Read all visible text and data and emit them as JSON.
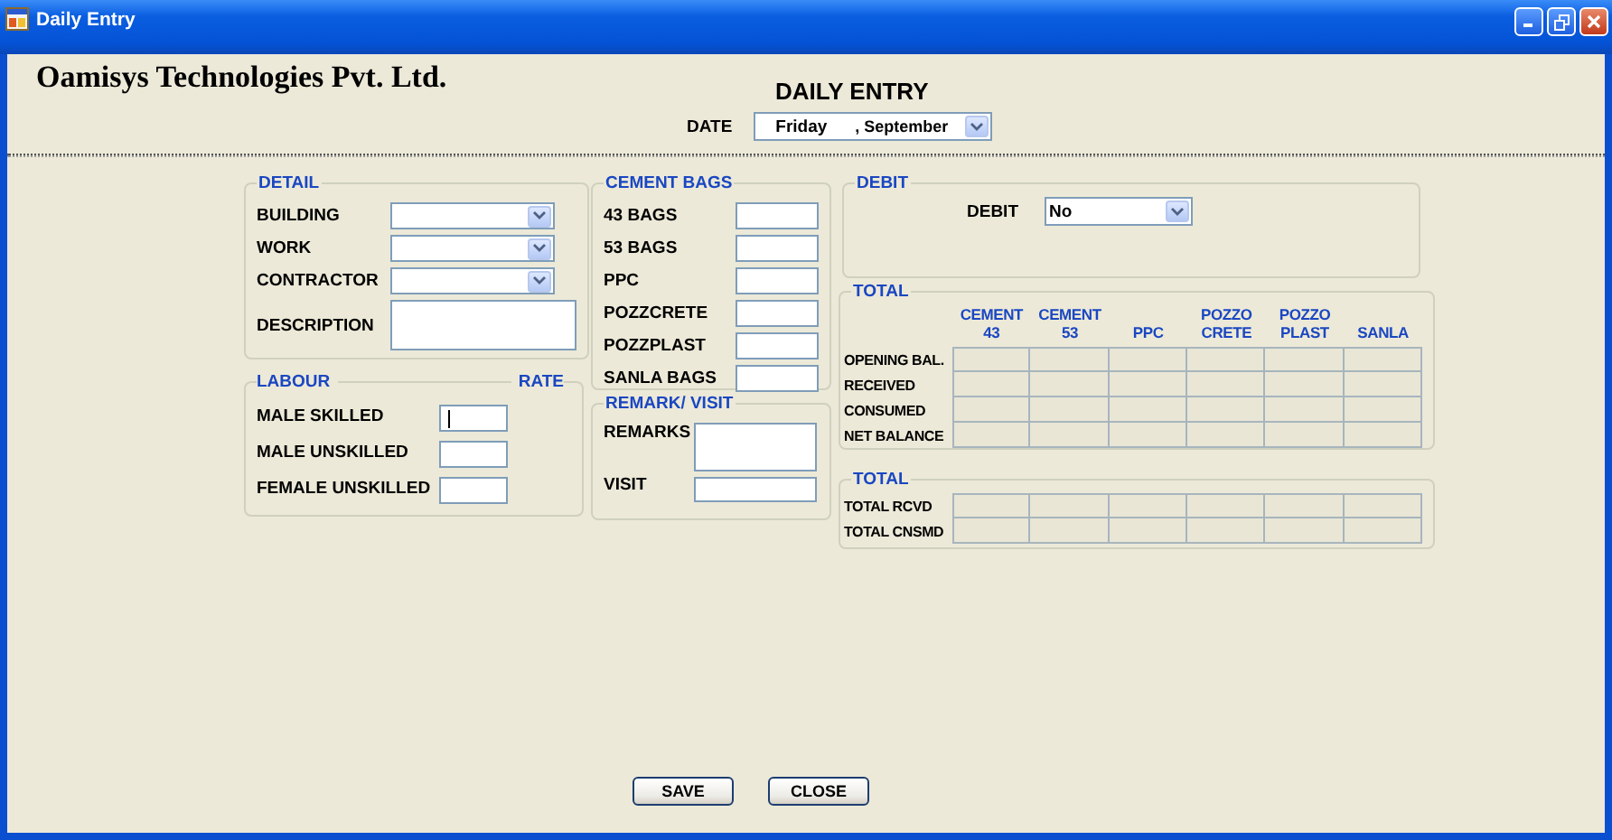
{
  "window": {
    "title": "Daily Entry"
  },
  "header": {
    "company": "Oamisys Technologies Pvt. Ltd.",
    "title": "DAILY ENTRY",
    "date_label": "DATE",
    "date_day": "Friday",
    "date_month": ", September"
  },
  "detail": {
    "legend": "DETAIL",
    "fields": [
      {
        "label": "BUILDING",
        "kind": "combo"
      },
      {
        "label": "WORK",
        "kind": "combo"
      },
      {
        "label": "CONTRACTOR",
        "kind": "combo"
      },
      {
        "label": "DESCRIPTION",
        "kind": "textarea"
      }
    ]
  },
  "labour": {
    "legend": "LABOUR",
    "rate_header": "RATE",
    "fields": [
      {
        "label": "MALE SKILLED",
        "focused": true
      },
      {
        "label": "MALE UNSKILLED",
        "focused": false
      },
      {
        "label": "FEMALE UNSKILLED",
        "focused": false
      }
    ]
  },
  "cement_bags": {
    "legend": "CEMENT BAGS",
    "fields": [
      "43 BAGS",
      "53 BAGS",
      "PPC",
      "POZZCRETE",
      "POZZPLAST",
      "SANLA BAGS"
    ]
  },
  "remark_visit": {
    "legend": "REMARK/ VISIT",
    "fields": [
      {
        "label": "REMARKS",
        "kind": "textarea"
      },
      {
        "label": "VISIT",
        "kind": "text"
      }
    ]
  },
  "debit": {
    "legend": "DEBIT",
    "label": "DEBIT",
    "value": "No"
  },
  "total": {
    "legend": "TOTAL",
    "columns": [
      "CEMENT 43",
      "CEMENT 53",
      "PPC",
      "POZZO CRETE",
      "POZZO PLAST",
      "SANLA"
    ],
    "rows": [
      "OPENING BAL.",
      "RECEIVED",
      "CONSUMED",
      "NET BALANCE"
    ]
  },
  "total_summary": {
    "legend": "TOTAL",
    "rows": [
      "TOTAL RCVD",
      "TOTAL CNSMD"
    ]
  },
  "buttons": [
    {
      "label": "SAVE"
    },
    {
      "label": "CLOSE"
    }
  ]
}
